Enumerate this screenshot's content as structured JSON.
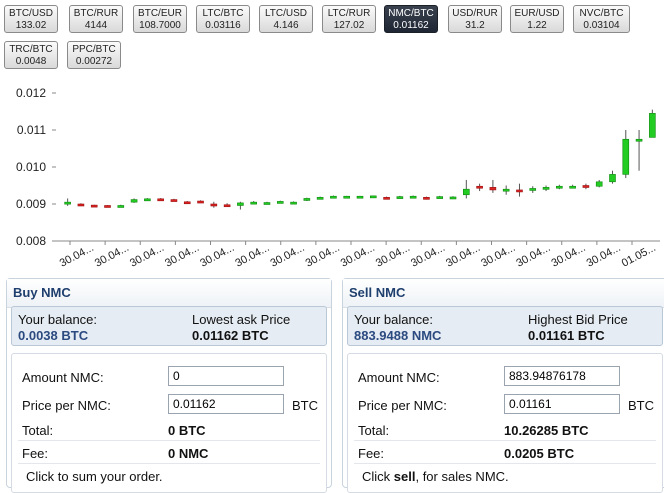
{
  "pairs": [
    {
      "name": "BTC/USD",
      "value": "133.02",
      "active": false
    },
    {
      "name": "BTC/RUR",
      "value": "4144",
      "active": false
    },
    {
      "name": "BTC/EUR",
      "value": "108.7000",
      "active": false
    },
    {
      "name": "LTC/BTC",
      "value": "0.03116",
      "active": false
    },
    {
      "name": "LTC/USD",
      "value": "4.146",
      "active": false
    },
    {
      "name": "LTC/RUR",
      "value": "127.02",
      "active": false
    },
    {
      "name": "NMC/BTC",
      "value": "0.01162",
      "active": true
    },
    {
      "name": "USD/RUR",
      "value": "31.2",
      "active": false
    },
    {
      "name": "EUR/USD",
      "value": "1.22",
      "active": false
    },
    {
      "name": "NVC/BTC",
      "value": "0.03104",
      "active": false
    },
    {
      "name": "TRC/BTC",
      "value": "0.0048",
      "active": false
    },
    {
      "name": "PPC/BTC",
      "value": "0.00272",
      "active": false
    }
  ],
  "chart_data": {
    "type": "candlestick",
    "ylim": [
      0.008,
      0.0123
    ],
    "yticks": [
      "0.012",
      "0.011",
      "0.010",
      "0.009",
      "0.008"
    ],
    "xlabels": [
      "30.04...",
      "30.04...",
      "30.04...",
      "30.04...",
      "30.04...",
      "30.04...",
      "30.04...",
      "30.04...",
      "30.04...",
      "30.04...",
      "30.04...",
      "30.04...",
      "30.04...",
      "30.04...",
      "30.04...",
      "30.04...",
      "01.05..."
    ],
    "colors": {
      "up": "#22cc22",
      "down": "#dd2222"
    },
    "candles": [
      {
        "o": 0.009,
        "c": 0.00905,
        "h": 0.00915,
        "l": 0.00895
      },
      {
        "o": 0.009,
        "c": 0.00898,
        "h": 0.00902,
        "l": 0.00896
      },
      {
        "o": 0.00897,
        "c": 0.00896,
        "h": 0.00898,
        "l": 0.00894
      },
      {
        "o": 0.00896,
        "c": 0.00895,
        "h": 0.00897,
        "l": 0.00893
      },
      {
        "o": 0.00895,
        "c": 0.00896,
        "h": 0.00898,
        "l": 0.00893
      },
      {
        "o": 0.00905,
        "c": 0.00912,
        "h": 0.00915,
        "l": 0.00903
      },
      {
        "o": 0.00912,
        "c": 0.00914,
        "h": 0.00916,
        "l": 0.0091
      },
      {
        "o": 0.00914,
        "c": 0.00912,
        "h": 0.00916,
        "l": 0.0091
      },
      {
        "o": 0.00912,
        "c": 0.00911,
        "h": 0.00914,
        "l": 0.00909
      },
      {
        "o": 0.00906,
        "c": 0.00905,
        "h": 0.00908,
        "l": 0.00903
      },
      {
        "o": 0.00908,
        "c": 0.00907,
        "h": 0.0091,
        "l": 0.00905
      },
      {
        "o": 0.009,
        "c": 0.00898,
        "h": 0.00906,
        "l": 0.0089
      },
      {
        "o": 0.00898,
        "c": 0.00896,
        "h": 0.00902,
        "l": 0.00893
      },
      {
        "o": 0.00896,
        "c": 0.00903,
        "h": 0.00906,
        "l": 0.00885
      },
      {
        "o": 0.00902,
        "c": 0.00905,
        "h": 0.00908,
        "l": 0.009
      },
      {
        "o": 0.00902,
        "c": 0.00904,
        "h": 0.00906,
        "l": 0.009
      },
      {
        "o": 0.00904,
        "c": 0.00907,
        "h": 0.00909,
        "l": 0.00902
      },
      {
        "o": 0.00903,
        "c": 0.00905,
        "h": 0.00907,
        "l": 0.00901
      },
      {
        "o": 0.0091,
        "c": 0.00915,
        "h": 0.00917,
        "l": 0.00908
      },
      {
        "o": 0.00915,
        "c": 0.00918,
        "h": 0.0092,
        "l": 0.00913
      },
      {
        "o": 0.00919,
        "c": 0.00921,
        "h": 0.00923,
        "l": 0.00917
      },
      {
        "o": 0.0092,
        "c": 0.00921,
        "h": 0.00922,
        "l": 0.00918
      },
      {
        "o": 0.0092,
        "c": 0.00921,
        "h": 0.00922,
        "l": 0.00918
      },
      {
        "o": 0.00921,
        "c": 0.00922,
        "h": 0.00923,
        "l": 0.00919
      },
      {
        "o": 0.00918,
        "c": 0.00917,
        "h": 0.0092,
        "l": 0.00915
      },
      {
        "o": 0.00919,
        "c": 0.0092,
        "h": 0.00922,
        "l": 0.00917
      },
      {
        "o": 0.0092,
        "c": 0.00921,
        "h": 0.00923,
        "l": 0.00918
      },
      {
        "o": 0.00918,
        "c": 0.00915,
        "h": 0.0092,
        "l": 0.00912
      },
      {
        "o": 0.00918,
        "c": 0.0092,
        "h": 0.00922,
        "l": 0.00916
      },
      {
        "o": 0.00918,
        "c": 0.00919,
        "h": 0.00921,
        "l": 0.00916
      },
      {
        "o": 0.00925,
        "c": 0.0094,
        "h": 0.00965,
        "l": 0.00915
      },
      {
        "o": 0.00948,
        "c": 0.00943,
        "h": 0.00955,
        "l": 0.00935
      },
      {
        "o": 0.00945,
        "c": 0.00938,
        "h": 0.00965,
        "l": 0.0093
      },
      {
        "o": 0.00935,
        "c": 0.0094,
        "h": 0.0095,
        "l": 0.00925
      },
      {
        "o": 0.00938,
        "c": 0.00937,
        "h": 0.00955,
        "l": 0.0092
      },
      {
        "o": 0.00937,
        "c": 0.00942,
        "h": 0.00948,
        "l": 0.0093
      },
      {
        "o": 0.0094,
        "c": 0.00945,
        "h": 0.0095,
        "l": 0.00935
      },
      {
        "o": 0.00945,
        "c": 0.00948,
        "h": 0.00952,
        "l": 0.0094
      },
      {
        "o": 0.00946,
        "c": 0.00948,
        "h": 0.00952,
        "l": 0.00943
      },
      {
        "o": 0.0095,
        "c": 0.00945,
        "h": 0.00955,
        "l": 0.0094
      },
      {
        "o": 0.00948,
        "c": 0.0096,
        "h": 0.00965,
        "l": 0.00945
      },
      {
        "o": 0.0096,
        "c": 0.0098,
        "h": 0.0099,
        "l": 0.00955
      },
      {
        "o": 0.0098,
        "c": 0.01075,
        "h": 0.011,
        "l": 0.0097
      },
      {
        "o": 0.01075,
        "c": 0.01075,
        "h": 0.011,
        "l": 0.0099
      },
      {
        "o": 0.0108,
        "c": 0.01145,
        "h": 0.01155,
        "l": 0.0108
      }
    ]
  },
  "buy": {
    "title": "Buy NMC",
    "balance_label": "Your balance:",
    "balance_value": "0.0038 BTC",
    "price_label": "Lowest ask Price",
    "price_value": "0.01162 BTC",
    "amount_label": "Amount NMC:",
    "amount_value": "0",
    "ppu_label": "Price per NMC:",
    "ppu_value": "0.01162",
    "ppu_unit": "BTC",
    "total_label": "Total:",
    "total_value": "0 BTC",
    "fee_label": "Fee:",
    "fee_value": "0 NMC",
    "hint": "Click to sum your order."
  },
  "sell": {
    "title": "Sell NMC",
    "balance_label": "Your balance:",
    "balance_value": "883.9488 NMC",
    "price_label": "Highest Bid Price",
    "price_value": "0.01161 BTC",
    "amount_label": "Amount NMC:",
    "amount_value": "883.94876178",
    "ppu_label": "Price per NMC:",
    "ppu_value": "0.01161",
    "ppu_unit": "BTC",
    "total_label": "Total:",
    "total_value": "10.26285 BTC",
    "fee_label": "Fee:",
    "fee_value": "0.0205 BTC",
    "hint_prefix": "Click ",
    "hint_bold": "sell",
    "hint_suffix": ", for sales NMC."
  }
}
